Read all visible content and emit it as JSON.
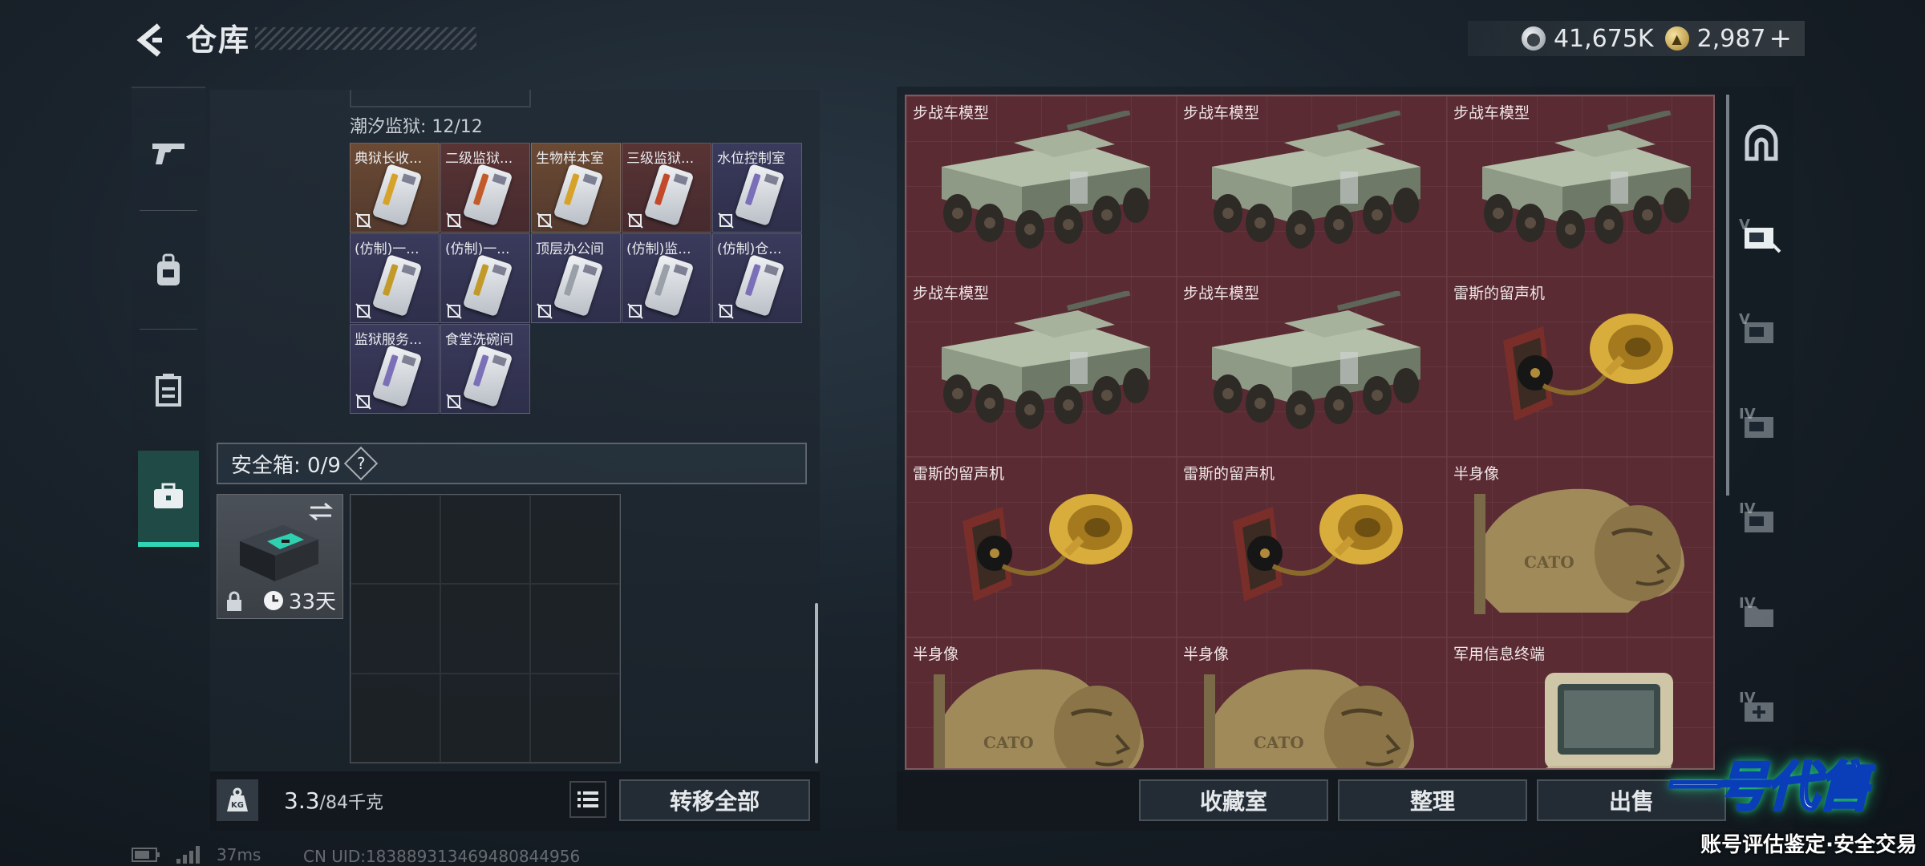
{
  "header": {
    "title": "仓库"
  },
  "currency": {
    "silver": "41,675K",
    "gold": "2,987",
    "plus": "+"
  },
  "sidebar": {
    "items": [
      {
        "name": "weapons",
        "icon": "gun-icon"
      },
      {
        "name": "equipment",
        "icon": "backpack-icon"
      },
      {
        "name": "containers",
        "icon": "crate-icon"
      },
      {
        "name": "safe-box",
        "icon": "briefcase-icon",
        "active": true
      }
    ]
  },
  "left_panel": {
    "prison_label": "潮汐监狱: 12/12",
    "keycards": [
      {
        "name": "典狱长收...",
        "color": "gold",
        "stripe": "#d6a22a"
      },
      {
        "name": "二级监狱...",
        "color": "red",
        "stripe": "#c25a2a"
      },
      {
        "name": "生物样本室",
        "color": "gold",
        "stripe": "#d6a22a"
      },
      {
        "name": "三级监狱...",
        "color": "red",
        "stripe": "#c24a2a"
      },
      {
        "name": "水位控制室",
        "color": "purple",
        "stripe": "#7b6fb8"
      },
      {
        "name": "(仿制)一...",
        "color": "purple",
        "stripe": "#c29a2a"
      },
      {
        "name": "(仿制)一...",
        "color": "purple",
        "stripe": "#c29a2a"
      },
      {
        "name": "顶层办公间",
        "color": "purple",
        "stripe": "#9aa0a8"
      },
      {
        "name": "(仿制)监...",
        "color": "purple",
        "stripe": "#9aa0a8"
      },
      {
        "name": "(仿制)仓...",
        "color": "purple",
        "stripe": "#7b6fb8"
      },
      {
        "name": "监狱服务...",
        "color": "purple",
        "stripe": "#7b6fb8"
      },
      {
        "name": "食堂洗碗间",
        "color": "purple",
        "stripe": "#7b6fb8"
      }
    ],
    "safe_box": {
      "label": "安全箱: 0/9",
      "help": "?"
    },
    "case_timer": "33天",
    "weight_value": "3.3",
    "weight_capacity": "/84千克",
    "transfer_all": "转移全部",
    "kg_label": "KG"
  },
  "items": [
    {
      "name": "步战车模型",
      "kind": "ifv"
    },
    {
      "name": "步战车模型",
      "kind": "ifv"
    },
    {
      "name": "步战车模型",
      "kind": "ifv"
    },
    {
      "name": "步战车模型",
      "kind": "ifv"
    },
    {
      "name": "步战车模型",
      "kind": "ifv"
    },
    {
      "name": "雷斯的留声机",
      "kind": "gramophone"
    },
    {
      "name": "雷斯的留声机",
      "kind": "gramophone"
    },
    {
      "name": "雷斯的留声机",
      "kind": "gramophone"
    },
    {
      "name": "半身像",
      "kind": "bust"
    },
    {
      "name": "半身像",
      "kind": "bust"
    },
    {
      "name": "半身像",
      "kind": "bust"
    },
    {
      "name": "军用信息终端",
      "kind": "terminal"
    }
  ],
  "right_tabs": [
    {
      "name": "tab-all",
      "icon": "arch-icon",
      "roman": ""
    },
    {
      "name": "tab-v",
      "icon": "keycard-v-icon",
      "roman": "V",
      "active": true
    },
    {
      "name": "tab-v2",
      "icon": "keycard-v2-icon",
      "roman": "V"
    },
    {
      "name": "tab-iv",
      "icon": "keycard-iv-icon",
      "roman": "IV"
    },
    {
      "name": "tab-iv2",
      "icon": "keycard-iv2-icon",
      "roman": "IV"
    },
    {
      "name": "tab-iv3",
      "icon": "folder-iv-icon",
      "roman": "IV"
    },
    {
      "name": "tab-iv4",
      "icon": "medkit-iv-icon",
      "roman": "IV"
    }
  ],
  "actions": {
    "collection": "收藏室",
    "organize": "整理",
    "sell": "出售"
  },
  "footer": {
    "ping": "37ms",
    "uid": "CN UID:1838893134694808449​56"
  },
  "watermark": {
    "logo": "一号代售",
    "sub": "账号评估鉴定·安全交易"
  }
}
